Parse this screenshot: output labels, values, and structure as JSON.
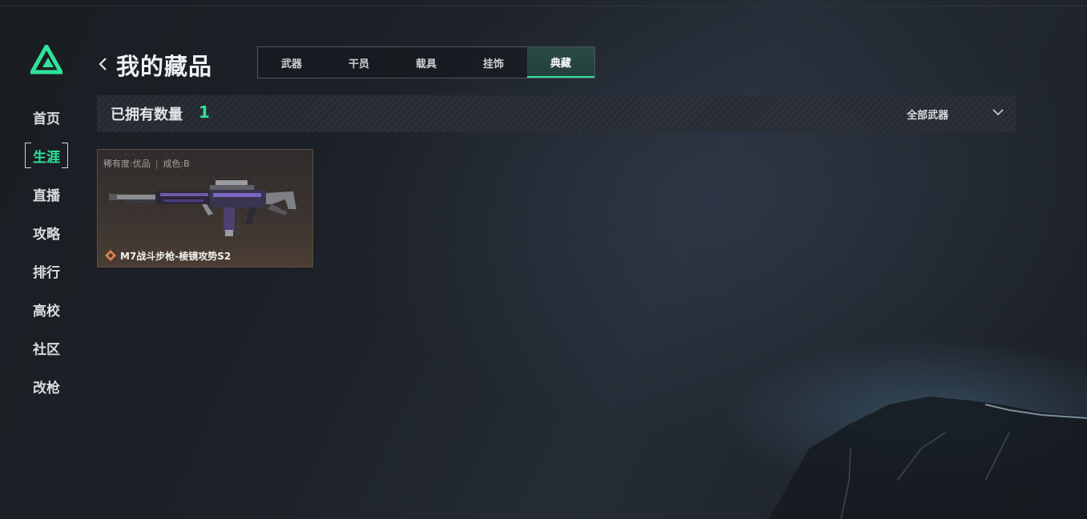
{
  "sidebar": {
    "items": [
      {
        "label": "首页"
      },
      {
        "label": "生涯",
        "active": true
      },
      {
        "label": "直播"
      },
      {
        "label": "攻略"
      },
      {
        "label": "排行"
      },
      {
        "label": "高校"
      },
      {
        "label": "社区"
      },
      {
        "label": "改枪"
      }
    ]
  },
  "header": {
    "title": "我的藏品",
    "tabs": [
      {
        "label": "武器"
      },
      {
        "label": "干员"
      },
      {
        "label": "载具"
      },
      {
        "label": "挂饰"
      },
      {
        "label": "典藏",
        "active": true
      }
    ]
  },
  "summary": {
    "owned_label": "已拥有数量",
    "owned_count": "1",
    "filter_label": "全部武器"
  },
  "items": [
    {
      "rarity": "稀有度:优品",
      "condition": "成色:B",
      "name": "M7战斗步枪-棱镜攻势S2"
    }
  ],
  "colors": {
    "accent": "#2fe39b",
    "background": "#1d2128",
    "card_border": "#5a4e42",
    "rarity_icon": "#d9814a"
  }
}
